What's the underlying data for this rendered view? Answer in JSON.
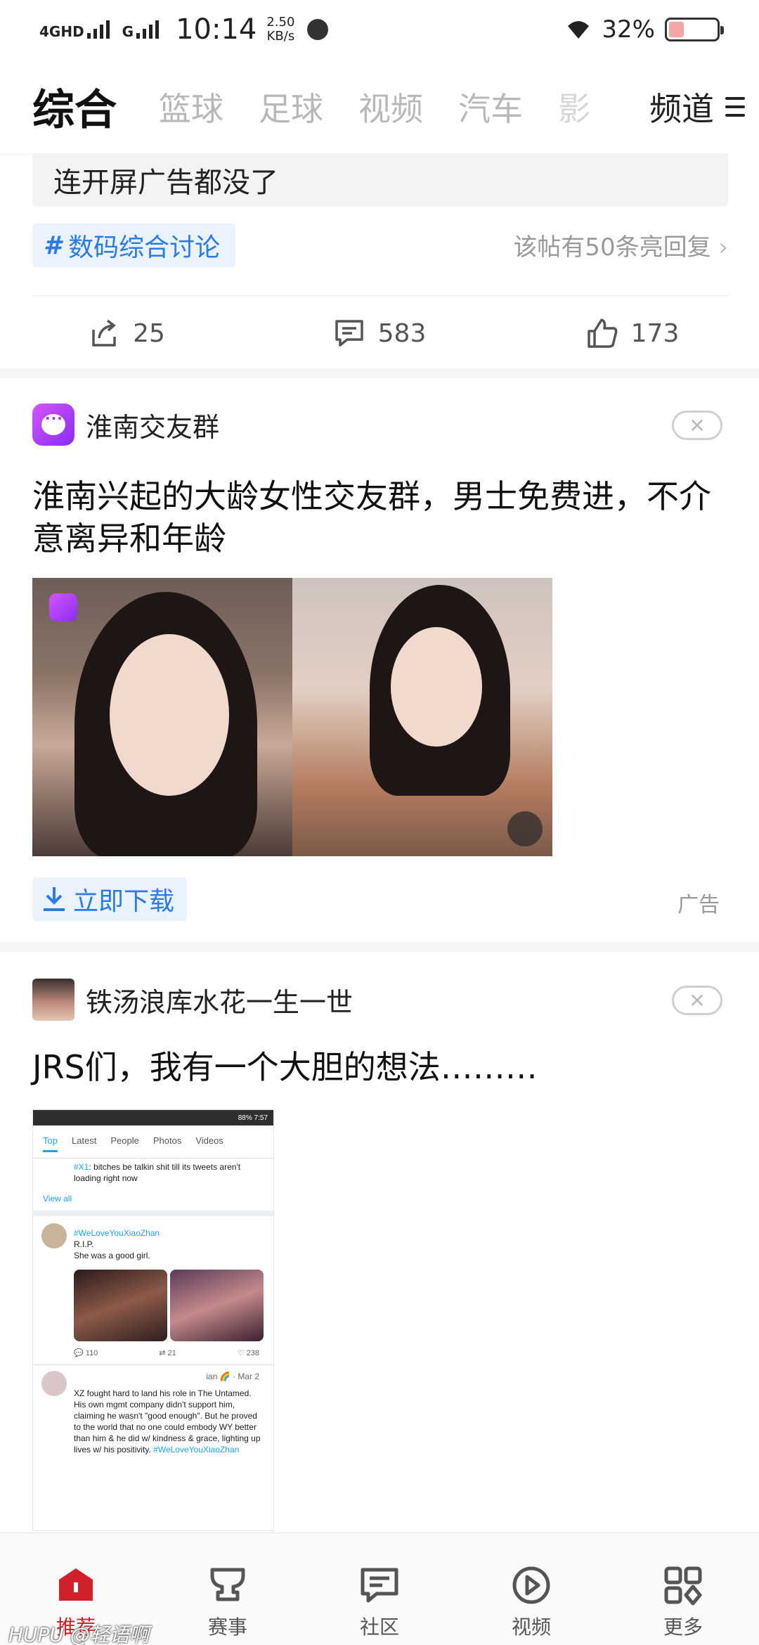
{
  "status_bar": {
    "network_1": "4GHD",
    "network_2": "G",
    "time": "10:14",
    "speed_value": "2.50",
    "speed_unit": "KB/s",
    "battery_pct": "32%",
    "battery_level": 0.32
  },
  "top_tabs": {
    "items": [
      "综合",
      "篮球",
      "足球",
      "视频",
      "汽车",
      "影"
    ],
    "active_index": 0,
    "channel_label": "频道"
  },
  "post1": {
    "quote": "连开屏广告都没了",
    "topic": "数码综合讨论",
    "reply_hint": "该帖有50条亮回复",
    "share_count": "25",
    "comment_count": "583",
    "like_count": "173"
  },
  "ad_post": {
    "author": "淮南交友群",
    "close_glyph": "✕",
    "title": "淮南兴起的大龄女性交友群，男士免费进，不介意离异和年龄",
    "download_label": "立即下载",
    "ad_label": "广告"
  },
  "post3": {
    "author": "铁汤浪库水花一生一世",
    "close_glyph": "✕",
    "title": "JRS们，我有一个大胆的想法………",
    "screenshot": {
      "status_text": "88% 7:57",
      "tabs": [
        "Top",
        "Latest",
        "People",
        "Photos",
        "Videos"
      ],
      "tweet1_tag": "#X1",
      "tweet1_text": ": bitches be talkin shit till its tweets aren't loading right now",
      "view_all": "View all",
      "tweet2_tag": "#WeLoveYouXiaoZhan",
      "tweet2_line1": "R.I.P.",
      "tweet2_line2": "She was a good girl.",
      "stat_replies": "110",
      "stat_retweets": "21",
      "stat_likes": "238",
      "tweet3_meta": "ian 🌈 · Mar 2",
      "tweet3_text": "XZ fought hard to land his role in The Untamed. His own mgmt company didn't support him, claiming he wasn't \"good enough\". But he proved to the world that no one could embody WY better than him & he did w/ kindness & grace, lighting up lives w/ his positivity.",
      "tweet3_tag": "#WeLoveYouXiaoZhan"
    }
  },
  "bottom_nav": {
    "items": [
      "推荐",
      "赛事",
      "社区",
      "视频",
      "更多"
    ],
    "active_index": 0
  },
  "watermark": "HUPU @轻语啊",
  "colors": {
    "accent_blue": "#2b7be6",
    "active_red": "#d2202a",
    "tag_bg": "#eaf2fd"
  }
}
